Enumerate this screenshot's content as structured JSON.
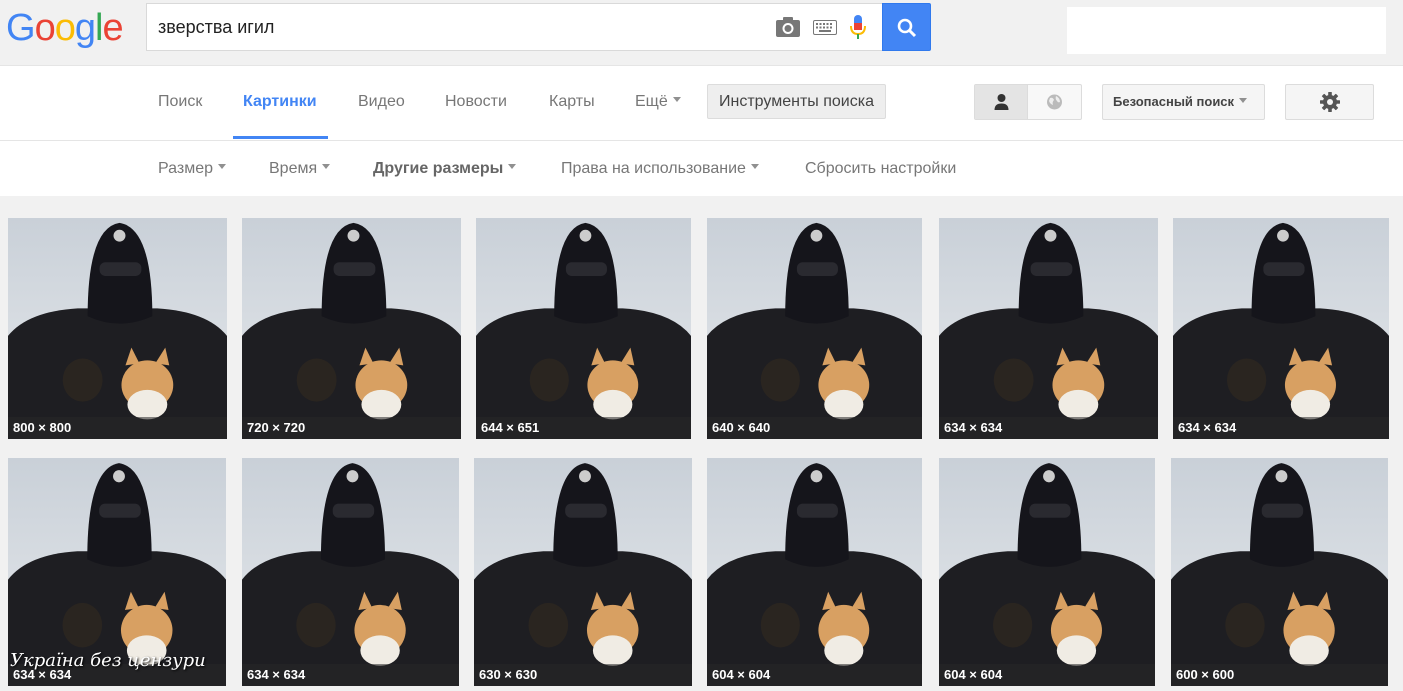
{
  "header": {
    "logo_letters": [
      {
        "ch": "G",
        "color": "#4285f4"
      },
      {
        "ch": "o",
        "color": "#ea4335"
      },
      {
        "ch": "o",
        "color": "#fbbc05"
      },
      {
        "ch": "g",
        "color": "#4285f4"
      },
      {
        "ch": "l",
        "color": "#34a853"
      },
      {
        "ch": "e",
        "color": "#ea4335"
      }
    ],
    "query": "зверства игил",
    "icons": [
      "camera-icon",
      "keyboard-icon",
      "microphone-icon",
      "search-icon"
    ]
  },
  "nav": {
    "tabs": [
      {
        "label": "Поиск",
        "active": false
      },
      {
        "label": "Картинки",
        "active": true
      },
      {
        "label": "Видео",
        "active": false
      },
      {
        "label": "Новости",
        "active": false
      },
      {
        "label": "Карты",
        "active": false
      },
      {
        "label": "Ещё",
        "active": false
      }
    ],
    "tools_label": "Инструменты поиска",
    "safe_search_label": "Безопасный поиск",
    "accent": "#4285f4"
  },
  "filters": [
    {
      "label": "Размер",
      "caret": true
    },
    {
      "label": "Время",
      "caret": true
    },
    {
      "label": "Другие размеры",
      "caret": true
    },
    {
      "label": "Права на использование",
      "caret": true
    },
    {
      "label": "Сбросить настройки",
      "caret": false
    }
  ],
  "results": {
    "row1": [
      "800 × 800",
      "720 × 720",
      "644 × 651",
      "640 × 640",
      "634 × 634",
      "634 × 634"
    ],
    "row2": [
      "634 × 634",
      "634 × 634",
      "630 × 630",
      "604 × 604",
      "604 × 604",
      "600 × 600"
    ]
  },
  "watermark": "Україна без цензури"
}
